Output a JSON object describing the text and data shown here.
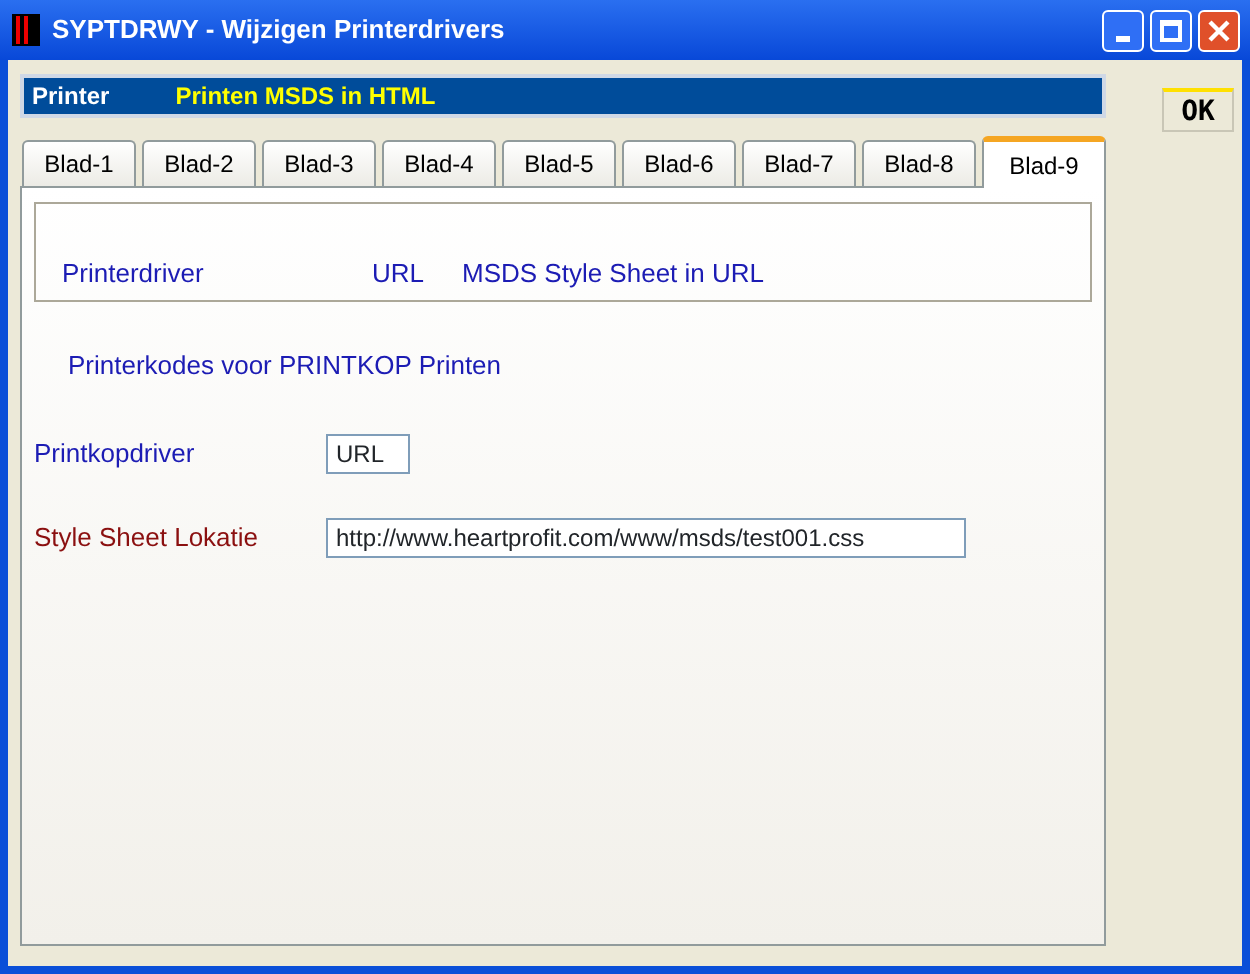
{
  "window": {
    "title": "SYPTDRWY - Wijzigen Printerdrivers"
  },
  "header": {
    "label": "Printer",
    "value": "Printen MSDS in HTML"
  },
  "tabs": [
    {
      "label": "Blad-1",
      "selected": false
    },
    {
      "label": "Blad-2",
      "selected": false
    },
    {
      "label": "Blad-3",
      "selected": false
    },
    {
      "label": "Blad-4",
      "selected": false
    },
    {
      "label": "Blad-5",
      "selected": false
    },
    {
      "label": "Blad-6",
      "selected": false
    },
    {
      "label": "Blad-7",
      "selected": false
    },
    {
      "label": "Blad-8",
      "selected": false
    },
    {
      "label": "Blad-9",
      "selected": true
    }
  ],
  "info_box": {
    "label": "Printerdriver",
    "type": "URL",
    "description": "MSDS Style Sheet in URL"
  },
  "section_title": "Printerkodes voor PRINTKOP Printen",
  "fields": [
    {
      "label": "Printkopdriver",
      "value": "URL",
      "color": "#1c1cb4",
      "kind": "short"
    },
    {
      "label": "Style Sheet Lokatie",
      "value": "http://www.heartprofit.com/www/msds/test001.css",
      "color": "#8b1010",
      "kind": "long"
    }
  ],
  "buttons": [
    {
      "label": "OK"
    }
  ]
}
